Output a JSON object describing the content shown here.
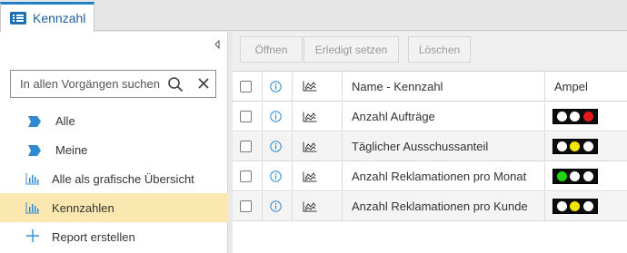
{
  "tab": {
    "label": "Kennzahl"
  },
  "sidebar": {
    "search_placeholder": "In allen Vorgängen suchen",
    "items": [
      {
        "label": "Alle",
        "icon": "tag-icon",
        "active": false
      },
      {
        "label": "Meine",
        "icon": "tag-icon",
        "active": false
      },
      {
        "label": "Alle als grafische Übersicht",
        "icon": "bar-chart-icon",
        "active": false
      },
      {
        "label": "Kennzahlen",
        "icon": "bar-chart-icon",
        "active": true
      },
      {
        "label": "Report erstellen",
        "icon": "plus-icon",
        "active": false
      }
    ]
  },
  "toolbar": {
    "open_label": "Öffnen",
    "done_label": "Erledigt setzen",
    "delete_label": "Löschen"
  },
  "table": {
    "columns": {
      "name": "Name - Kennzahl",
      "ampel": "Ampel"
    },
    "rows": [
      {
        "name": "Anzahl Aufträge",
        "lights": [
          "white",
          "white",
          "red"
        ]
      },
      {
        "name": "Täglicher Ausschussanteil",
        "lights": [
          "white",
          "yellow",
          "white"
        ]
      },
      {
        "name": "Anzahl Reklamationen pro Monat",
        "lights": [
          "green",
          "white",
          "white"
        ]
      },
      {
        "name": "Anzahl Reklamationen pro Kunde",
        "lights": [
          "white",
          "yellow",
          "white"
        ]
      }
    ]
  },
  "colors": {
    "accent": "#1f7fc7",
    "active_item": "#fbe7b0",
    "white": "#ffffff",
    "yellow": "#f2e600",
    "red": "#e8191b",
    "green": "#22d416"
  }
}
